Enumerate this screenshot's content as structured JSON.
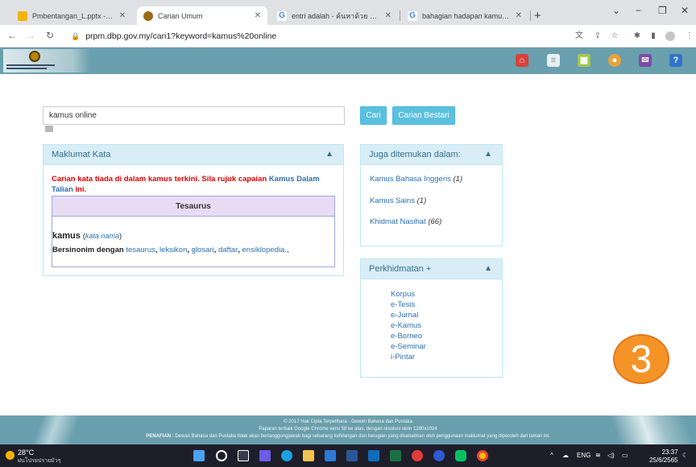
{
  "browser": {
    "tabs": [
      {
        "title": "Pmbentangan_L.pptx - Google"
      },
      {
        "title": "Carian Umum"
      },
      {
        "title": "entri adalah - ค้นหาด้วย Google"
      },
      {
        "title": "bahagian hadapan kamus dewa"
      }
    ],
    "new_tab": "+",
    "window_controls": {
      "minimize": "−",
      "restore": "❐",
      "close": "✕",
      "tab_menu": "⌄"
    },
    "url": "prpm.dbp.gov.my/cari1?keyword=kamus%20online"
  },
  "search": {
    "value": "kamus online",
    "cari_label": "Cari",
    "bestari_label": "Carian Bestari"
  },
  "maklumat": {
    "title": "Maklumat Kata",
    "notfound_prefix": "Carian kata tiada di dalam kamus terkini. Sila rujuk capaian ",
    "notfound_link": "Kamus Dalam Talian",
    "notfound_suffix": " ini.",
    "tesaurus_title": "Tesaurus",
    "word": "kamus",
    "open_paren": "(",
    "pos": "kata nama",
    "close_paren": ")",
    "syn_label": "Bersinonim dengan",
    "synonyms": [
      "tesaurus",
      "leksikon",
      "glosari",
      "daftar",
      "ensiklopedia"
    ],
    "syn_end": ".,"
  },
  "juga": {
    "title": "Juga ditemukan dalam:",
    "items": [
      {
        "name": "Kamus Bahasa Inggeris",
        "count": "(1)"
      },
      {
        "name": "Kamus Sains",
        "count": "(1)"
      },
      {
        "name": "Khidmat Nasihat",
        "count": "(66)"
      }
    ]
  },
  "perkhidmatan": {
    "title": "Perkhidmatan +",
    "items": [
      "Korpus",
      "e-Tesis",
      "e-Jurnal",
      "e-Kamus",
      "e-Borneo",
      "e-Seminar",
      "i-Pintar"
    ]
  },
  "badge": "3",
  "footer": {
    "line1": "© 2017 Hak Cipta Terpelihara - Dewan Bahasa dan Pustaka",
    "line2": "Paparan terbaik Google Chrome versi 58 ke atas, dengan resolusi skrin 1280x1024",
    "penafian_label": "PENAFIAN :",
    "penafian_text": " Dewan Bahasa dan Pustaka tidak akan bertanggungjawab bagi sebarang kehilangan dan kerugian yang disebabkan oleh penggunaan maklumat yang diperoleh dari laman ini."
  },
  "taskbar": {
    "temp": "28°C",
    "weather_desc": "ฝนโปรยปรายมัวๆ",
    "lang": "ENG",
    "time": "23:37",
    "date": "25/6/2565"
  },
  "colors": {
    "header_bg": "#6a9fad",
    "panel_head": "#d9edf7",
    "button": "#5bc0de",
    "error_text": "#e00000",
    "link": "#2a6fb6",
    "badge": "#f59426"
  }
}
